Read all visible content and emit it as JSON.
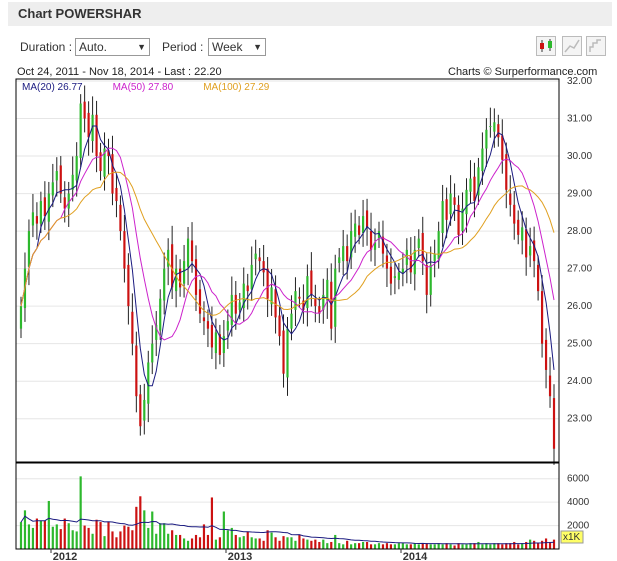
{
  "page_title": "Chart POWERSHAR",
  "controls": {
    "duration_label": "Duration :",
    "duration_value": "Auto.",
    "period_label": "Period :",
    "period_value": "Week"
  },
  "info": {
    "date_range": "Oct 24, 2011 - Nov 18, 2014 - Last : 22.20",
    "credit": "Charts © Surperformance.com"
  },
  "colors": {
    "up": "#2db82d",
    "down": "#cc1111",
    "ma20": "#1a1a80",
    "ma50": "#cc22cc",
    "ma100": "#e0a020"
  },
  "chart_data": {
    "type": "candlestick",
    "price_axis": {
      "ticks": [
        32.0,
        31.0,
        30.0,
        29.0,
        28.0,
        27.0,
        26.0,
        25.0,
        24.0,
        23.0
      ],
      "tick_labels": [
        "32.00",
        "31.00",
        "30.00",
        "29.00",
        "28.00",
        "27.00",
        "26.00",
        "25.00",
        "24.00",
        "23.00"
      ]
    },
    "volume_axis": {
      "ticks": [
        6000,
        4000,
        2000
      ],
      "tick_labels": [
        "6000",
        "4000",
        "2000"
      ],
      "unit_label": "x1K"
    },
    "x_labels": [
      "2012",
      "2013",
      "2014"
    ],
    "legend": [
      {
        "name": "MA(20)",
        "value": "26.77",
        "color": "#1a1a80"
      },
      {
        "name": "MA(50)",
        "value": "27.80",
        "color": "#cc22cc"
      },
      {
        "name": "MA(100)",
        "value": "27.29",
        "color": "#e0a020"
      }
    ],
    "weekly_close": [
      26.0,
      27.0,
      28.0,
      28.5,
      28.2,
      28.8,
      28.4,
      29.0,
      29.3,
      29.6,
      29.0,
      28.6,
      29.0,
      29.5,
      30.0,
      31.4,
      31.0,
      30.5,
      31.1,
      30.0,
      29.6,
      30.2,
      30.0,
      29.0,
      28.8,
      28.0,
      27.0,
      26.0,
      25.0,
      23.6,
      22.8,
      23.5,
      24.5,
      25.0,
      25.5,
      26.2,
      27.0,
      27.5,
      26.5,
      27.0,
      26.5,
      27.2,
      27.8,
      27.2,
      26.3,
      25.8,
      25.6,
      25.4,
      24.9,
      25.3,
      24.7,
      25.2,
      25.6,
      26.3,
      25.8,
      26.1,
      26.6,
      26.4,
      27.1,
      27.4,
      27.2,
      26.9,
      26.2,
      26.5,
      25.7,
      25.2,
      24.2,
      25.4,
      25.8,
      26.4,
      26.2,
      25.9,
      26.8,
      26.3,
      26.0,
      25.8,
      26.3,
      26.7,
      25.4,
      27.0,
      27.3,
      27.6,
      27.2,
      28.0,
      28.2,
      27.9,
      28.4,
      28.1,
      27.5,
      27.7,
      28.0,
      27.4,
      27.0,
      26.6,
      26.8,
      26.9,
      27.0,
      27.5,
      26.9,
      27.5,
      27.8,
      27.2,
      26.3,
      27.1,
      27.4,
      28.0,
      28.8,
      28.3,
      29.0,
      28.7,
      27.9,
      28.6,
      29.1,
      29.4,
      28.8,
      29.7,
      30.2,
      30.7,
      30.8,
      30.9,
      30.5,
      29.9,
      29.1,
      28.7,
      28.2,
      27.9,
      28.1,
      27.3,
      27.6,
      27.2,
      26.4,
      25.0,
      24.3,
      23.6,
      22.2
    ],
    "weekly_volume": [
      2300,
      3300,
      2100,
      1800,
      2600,
      2400,
      2400,
      4100,
      1900,
      2100,
      1700,
      2600,
      2200,
      1600,
      1500,
      6200,
      2000,
      1800,
      1300,
      2500,
      2300,
      1100,
      2300,
      1500,
      1000,
      1500,
      2000,
      1900,
      1600,
      3600,
      4500,
      3300,
      1800,
      3200,
      1300,
      2200,
      2200,
      1300,
      1600,
      1200,
      1200,
      900,
      700,
      900,
      1200,
      1000,
      2100,
      1200,
      4400,
      800,
      1000,
      3200,
      1600,
      1800,
      1200,
      1000,
      1100,
      1500,
      1000,
      900,
      900,
      700,
      1600,
      1400,
      1000,
      700,
      1100,
      1000,
      1000,
      700,
      1200,
      900,
      800,
      700,
      800,
      600,
      800,
      500,
      600,
      1200,
      500,
      400,
      700,
      400,
      500,
      500,
      600,
      600,
      400,
      400,
      500,
      400,
      500,
      400,
      400,
      500,
      500,
      400,
      400,
      500,
      400,
      500,
      500,
      400,
      400,
      500,
      400,
      500,
      400,
      300,
      500,
      400,
      400,
      500,
      500,
      600,
      400,
      500,
      400,
      500,
      500,
      400,
      500,
      500,
      600,
      400,
      500,
      600,
      800,
      700,
      500,
      700,
      900,
      600,
      800
    ]
  }
}
